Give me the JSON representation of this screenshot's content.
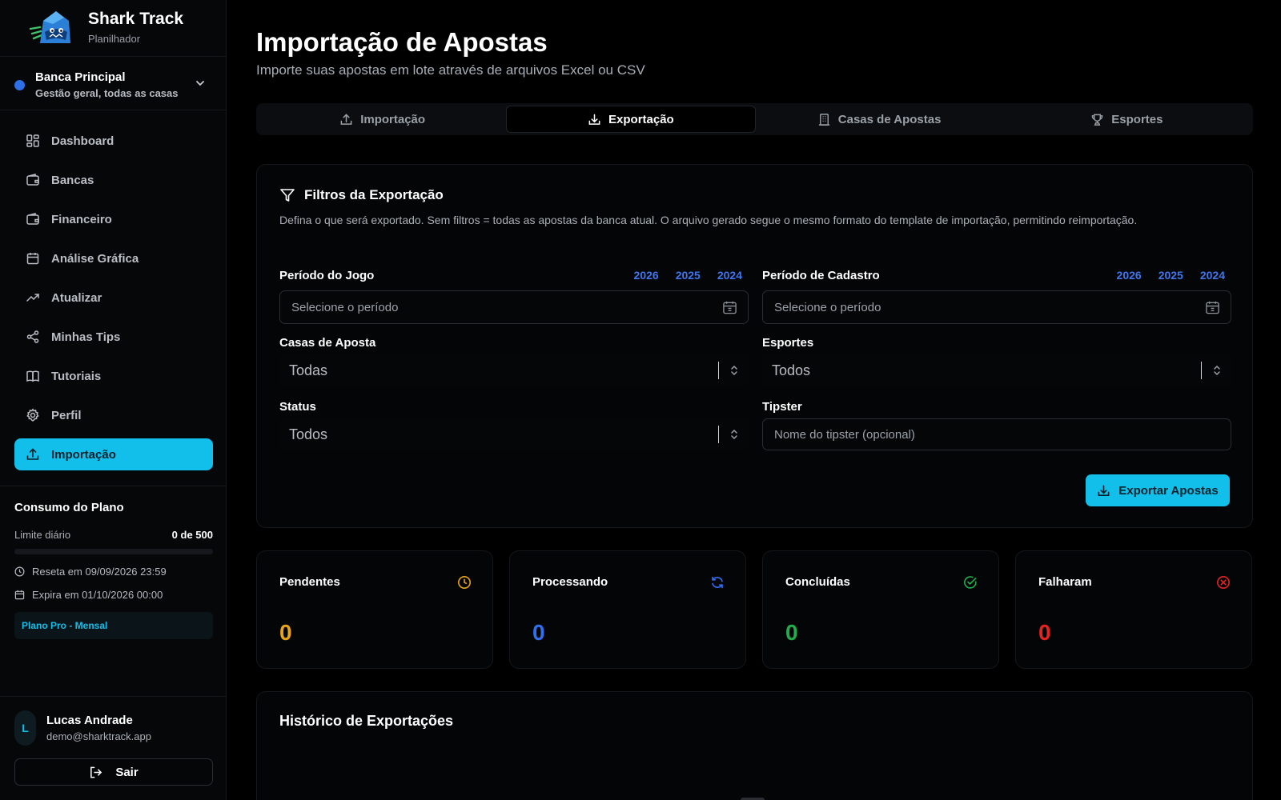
{
  "brand": {
    "title": "Shark Track",
    "subtitle": "Planilhador"
  },
  "bank": {
    "name": "Banca Principal",
    "description": "Gestão geral, todas as casas"
  },
  "nav": [
    {
      "label": "Dashboard",
      "icon": "dashboard-icon"
    },
    {
      "label": "Bancas",
      "icon": "wallet-icon"
    },
    {
      "label": "Financeiro",
      "icon": "wallet-icon"
    },
    {
      "label": "Análise Gráfica",
      "icon": "calendar-icon"
    },
    {
      "label": "Atualizar",
      "icon": "trend-icon"
    },
    {
      "label": "Minhas Tips",
      "icon": "share-icon"
    },
    {
      "label": "Tutoriais",
      "icon": "book-icon"
    },
    {
      "label": "Perfil",
      "icon": "gear-icon"
    },
    {
      "label": "Importação",
      "icon": "upload-icon",
      "active": true
    }
  ],
  "plan": {
    "title": "Consumo do Plano",
    "limit_label": "Limite diário",
    "limit_value": "0 de 500",
    "usage_fraction": 0,
    "reset_text": "Reseta em 09/09/2026 23:59",
    "expire_text": "Expira em 01/10/2026 00:00",
    "badge": "Plano Pro - Mensal"
  },
  "user": {
    "initial": "L",
    "name": "Lucas Andrade",
    "email": "demo@sharktrack.app",
    "logout_label": "Sair"
  },
  "page": {
    "title": "Importação de Apostas",
    "subtitle": "Importe suas apostas em lote através de arquivos Excel ou CSV"
  },
  "tabs": [
    {
      "label": "Importação",
      "icon": "upload-icon"
    },
    {
      "label": "Exportação",
      "icon": "download-icon",
      "active": true
    },
    {
      "label": "Casas de Apostas",
      "icon": "building-icon"
    },
    {
      "label": "Esportes",
      "icon": "trophy-icon"
    }
  ],
  "filters": {
    "title": "Filtros da Exportação",
    "description": "Defina o que será exportado. Sem filtros = todas as apostas da banca atual. O arquivo gerado segue o mesmo formato do template de importação, permitindo reimportação.",
    "game_period": {
      "label": "Período do Jogo",
      "placeholder": "Selecione o período",
      "years": [
        "2026",
        "2025",
        "2024"
      ]
    },
    "register_period": {
      "label": "Período de Cadastro",
      "placeholder": "Selecione o período",
      "years": [
        "2026",
        "2025",
        "2024"
      ]
    },
    "houses": {
      "label": "Casas de Aposta",
      "value": "Todas"
    },
    "sports": {
      "label": "Esportes",
      "value": "Todos"
    },
    "status": {
      "label": "Status",
      "value": "Todos"
    },
    "tipster": {
      "label": "Tipster",
      "placeholder": "Nome do tipster (opcional)"
    },
    "export_label": "Exportar Apostas"
  },
  "stats": [
    {
      "label": "Pendentes",
      "value": "0",
      "color": "#e8a317",
      "icon": "clock-icon"
    },
    {
      "label": "Processando",
      "value": "0",
      "color": "#2f6ff0",
      "icon": "refresh-icon"
    },
    {
      "label": "Concluídas",
      "value": "0",
      "color": "#1fae4a",
      "icon": "check-circle-icon"
    },
    {
      "label": "Falharam",
      "value": "0",
      "color": "#e5231f",
      "icon": "x-circle-icon"
    }
  ],
  "history": {
    "title": "Histórico de Exportações"
  },
  "colors": {
    "accent": "#12bfea",
    "link": "#3f76ee",
    "bank_dot": "#2d6fe6"
  }
}
